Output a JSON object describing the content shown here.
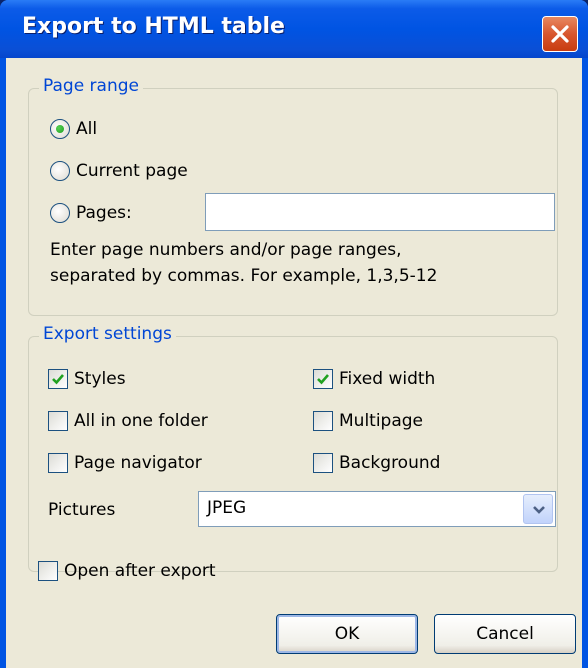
{
  "window": {
    "title": "Export to HTML table"
  },
  "page_range": {
    "legend": "Page range",
    "options": [
      {
        "label": "All",
        "selected": true
      },
      {
        "label": "Current page",
        "selected": false
      },
      {
        "label": "Pages:",
        "selected": false
      }
    ],
    "pages_value": "",
    "hint_line1": "Enter page numbers and/or page ranges,",
    "hint_line2": "separated by commas. For example, 1,3,5-12"
  },
  "export_settings": {
    "legend": "Export settings",
    "styles": {
      "label": "Styles",
      "checked": true
    },
    "fixed_width": {
      "label": "Fixed width",
      "checked": true
    },
    "all_in_one_folder": {
      "label": "All in one folder",
      "checked": false
    },
    "multipage": {
      "label": "Multipage",
      "checked": false
    },
    "page_navigator": {
      "label": "Page navigator",
      "checked": false
    },
    "background": {
      "label": "Background",
      "checked": false
    },
    "pictures_label": "Pictures",
    "pictures_value": "JPEG"
  },
  "open_after_export": {
    "label": "Open after export",
    "checked": false
  },
  "buttons": {
    "ok": "OK",
    "cancel": "Cancel"
  },
  "colors": {
    "titlebar": "#0054e3",
    "face": "#ece9d8",
    "legend_text": "#0046d5",
    "check_mark": "#21a121"
  }
}
